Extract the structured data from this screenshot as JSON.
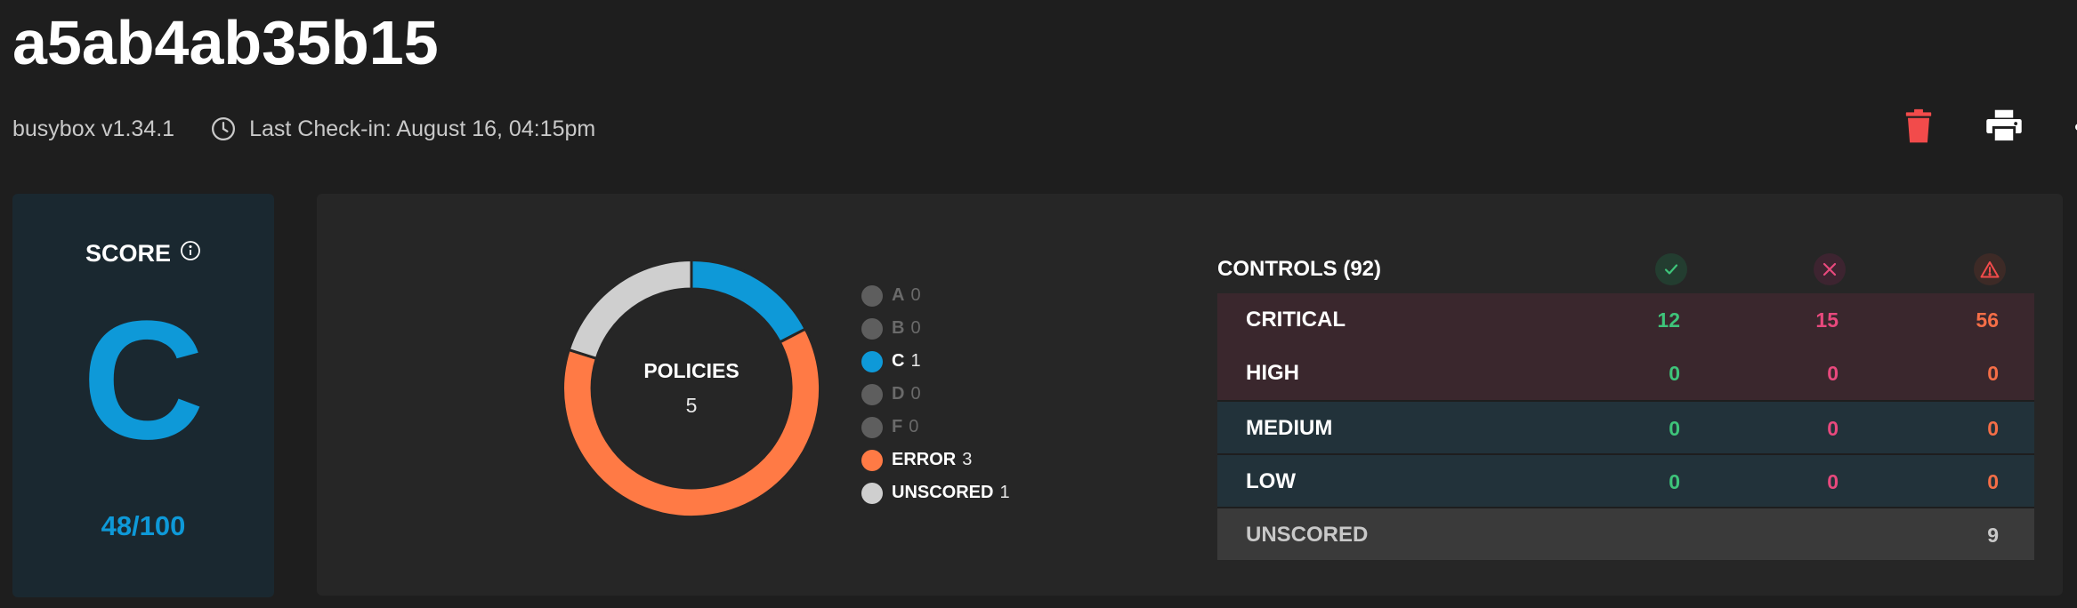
{
  "asset": {
    "title": "a5ab4ab35b15",
    "platform": "busybox v1.34.1",
    "last_checkin": "Last Check-in: August 16, 04:15pm"
  },
  "actions": {
    "delete_icon": "trash-icon",
    "print_icon": "printer-icon",
    "more_icon": "more-horizontal-icon"
  },
  "score": {
    "label": "SCORE",
    "grade": "C",
    "value": "48/100"
  },
  "policies": {
    "label": "POLICIES",
    "count": "5",
    "legend": [
      {
        "name": "A",
        "count": "0",
        "color": "#5e5e5e",
        "active": false
      },
      {
        "name": "B",
        "count": "0",
        "color": "#5e5e5e",
        "active": false
      },
      {
        "name": "C",
        "count": "1",
        "color": "#0e99d8",
        "active": true
      },
      {
        "name": "D",
        "count": "0",
        "color": "#5e5e5e",
        "active": false
      },
      {
        "name": "F",
        "count": "0",
        "color": "#5e5e5e",
        "active": false
      },
      {
        "name": "ERROR",
        "count": "3",
        "color": "#ff7a45",
        "active": true
      },
      {
        "name": "UNSCORED",
        "count": "1",
        "color": "#cfcfcf",
        "active": true
      }
    ]
  },
  "controls": {
    "title": "CONTROLS (92)",
    "header_icons": [
      "check-icon",
      "x-icon",
      "warning-triangle-icon"
    ],
    "rows": [
      {
        "name": "CRITICAL",
        "pass": "12",
        "fail": "15",
        "error": "56"
      },
      {
        "name": "HIGH",
        "pass": "0",
        "fail": "0",
        "error": "0"
      },
      {
        "name": "MEDIUM",
        "pass": "0",
        "fail": "0",
        "error": "0"
      },
      {
        "name": "LOW",
        "pass": "0",
        "fail": "0",
        "error": "0"
      },
      {
        "name": "UNSCORED",
        "pass": "",
        "fail": "",
        "error": "9"
      }
    ]
  },
  "colors": {
    "accent_blue": "#0e99d8",
    "pass_green": "#3ec47a",
    "fail_pink": "#e8497d",
    "error_orange": "#f46e47",
    "delete_red": "#f24b4b"
  }
}
